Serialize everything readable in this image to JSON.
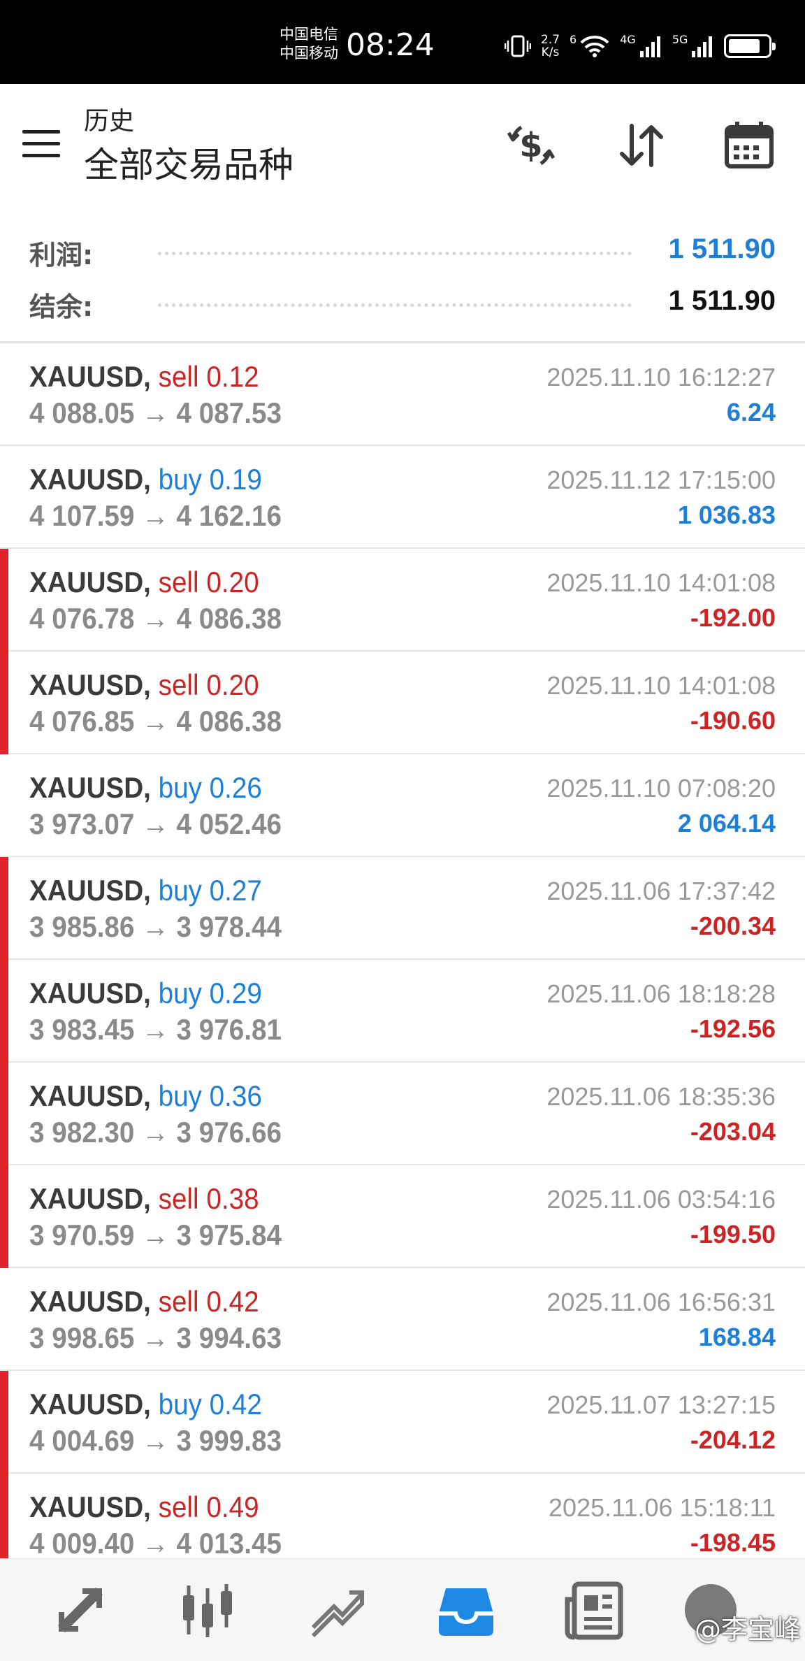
{
  "status_bar": {
    "carrier_1": "中国电信",
    "carrier_2": "中国移动",
    "time": "08:24",
    "speed_value": "2.7",
    "speed_unit": "K/s",
    "network_1": "4G",
    "network_2": "5G",
    "wifi_label": "6",
    "battery_level": 0.8
  },
  "header": {
    "subtitle": "历史",
    "title": "全部交易品种"
  },
  "summary": {
    "profit_label": "利润:",
    "profit_value": "1 511.90",
    "balance_label": "结余:",
    "balance_value": "1 511.90"
  },
  "trades": [
    {
      "symbol": "XAUUSD,",
      "side": "sell",
      "volume": "0.12",
      "open": "4 088.05",
      "close": "4 087.53",
      "time": "2025.11.10 16:12:27",
      "profit": "6.24",
      "loss": false
    },
    {
      "symbol": "XAUUSD,",
      "side": "buy",
      "volume": "0.19",
      "open": "4 107.59",
      "close": "4 162.16",
      "time": "2025.11.12 17:15:00",
      "profit": "1 036.83",
      "loss": false
    },
    {
      "symbol": "XAUUSD,",
      "side": "sell",
      "volume": "0.20",
      "open": "4 076.78",
      "close": "4 086.38",
      "time": "2025.11.10 14:01:08",
      "profit": "-192.00",
      "loss": true
    },
    {
      "symbol": "XAUUSD,",
      "side": "sell",
      "volume": "0.20",
      "open": "4 076.85",
      "close": "4 086.38",
      "time": "2025.11.10 14:01:08",
      "profit": "-190.60",
      "loss": true
    },
    {
      "symbol": "XAUUSD,",
      "side": "buy",
      "volume": "0.26",
      "open": "3 973.07",
      "close": "4 052.46",
      "time": "2025.11.10 07:08:20",
      "profit": "2 064.14",
      "loss": false
    },
    {
      "symbol": "XAUUSD,",
      "side": "buy",
      "volume": "0.27",
      "open": "3 985.86",
      "close": "3 978.44",
      "time": "2025.11.06 17:37:42",
      "profit": "-200.34",
      "loss": true
    },
    {
      "symbol": "XAUUSD,",
      "side": "buy",
      "volume": "0.29",
      "open": "3 983.45",
      "close": "3 976.81",
      "time": "2025.11.06 18:18:28",
      "profit": "-192.56",
      "loss": true
    },
    {
      "symbol": "XAUUSD,",
      "side": "buy",
      "volume": "0.36",
      "open": "3 982.30",
      "close": "3 976.66",
      "time": "2025.11.06 18:35:36",
      "profit": "-203.04",
      "loss": true
    },
    {
      "symbol": "XAUUSD,",
      "side": "sell",
      "volume": "0.38",
      "open": "3 970.59",
      "close": "3 975.84",
      "time": "2025.11.06 03:54:16",
      "profit": "-199.50",
      "loss": true
    },
    {
      "symbol": "XAUUSD,",
      "side": "sell",
      "volume": "0.42",
      "open": "3 998.65",
      "close": "3 994.63",
      "time": "2025.11.06 16:56:31",
      "profit": "168.84",
      "loss": false
    },
    {
      "symbol": "XAUUSD,",
      "side": "buy",
      "volume": "0.42",
      "open": "4 004.69",
      "close": "3 999.83",
      "time": "2025.11.07 13:27:15",
      "profit": "-204.12",
      "loss": true
    },
    {
      "symbol": "XAUUSD,",
      "side": "sell",
      "volume": "0.49",
      "open": "4 009.40",
      "close": "4 013.45",
      "time": "2025.11.06 15:18:11",
      "profit": "-198.45",
      "loss": true
    }
  ],
  "arrow": "→",
  "icons": {
    "menu": "menu-icon",
    "exchange": "currency-exchange-icon",
    "sort": "sort-icon",
    "calendar": "calendar-icon",
    "nav": [
      "trade-icon",
      "chart-candles-icon",
      "quotes-line-icon",
      "history-inbox-icon",
      "news-icon"
    ]
  },
  "colors": {
    "sell": "#cc2424",
    "buy": "#1e7fd8",
    "profit_positive": "#1e7fd8",
    "profit_negative": "#cc2424",
    "loss_marker": "#e0242a",
    "active_nav": "#1e88e5"
  },
  "watermark": "@李宝峰"
}
